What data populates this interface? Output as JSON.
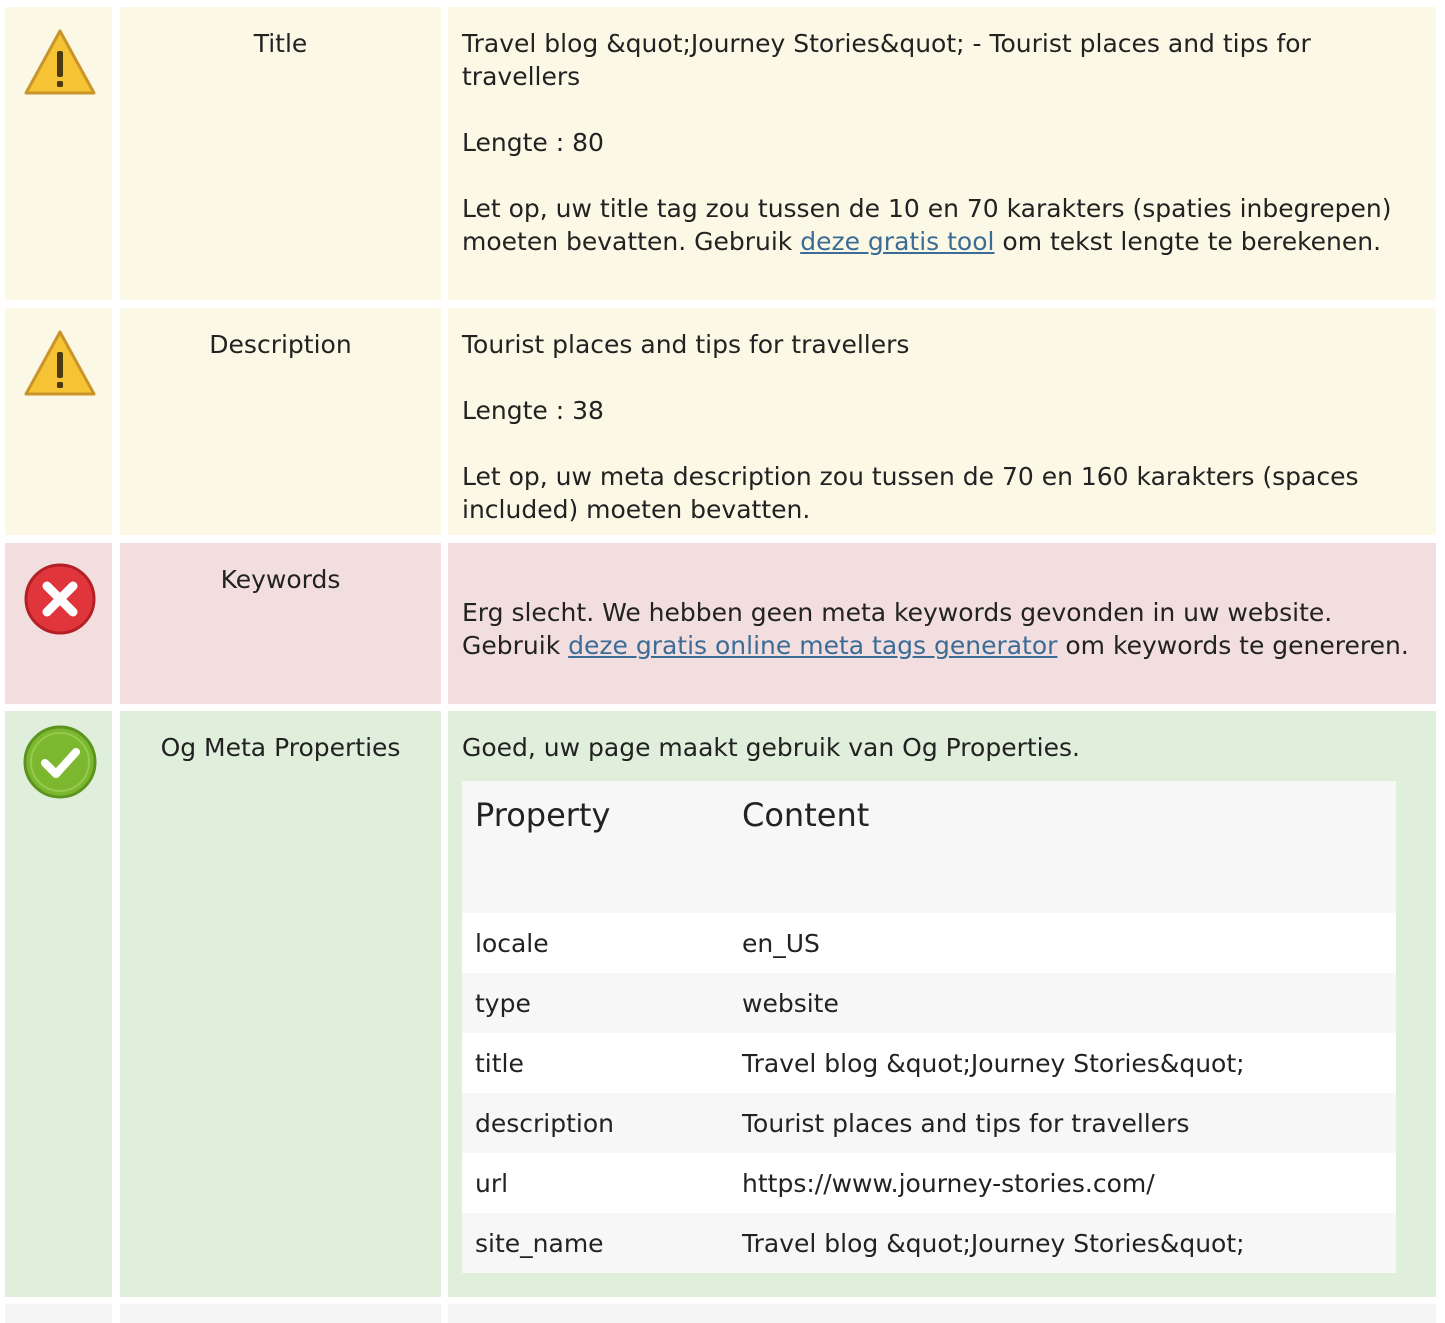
{
  "rows": {
    "title": {
      "status": "warning",
      "label": "Title",
      "value": "Travel blog &quot;Journey Stories&quot; - Tourist places and tips for travellers",
      "length": "Lengte : 80",
      "note_before": "Let op, uw title tag zou tussen de 10 en 70 karakters (spaties inbegrepen) moeten bevatten. Gebruik ",
      "note_link": "deze gratis tool",
      "note_after": " om tekst lengte te berekenen."
    },
    "description": {
      "status": "warning",
      "label": "Description",
      "value": "Tourist places and tips for travellers",
      "length": "Lengte : 38",
      "note": "Let op, uw meta description zou tussen de 70 en 160 karakters (spaces included) moeten bevatten."
    },
    "keywords": {
      "status": "error",
      "label": "Keywords",
      "note_before": "Erg slecht. We hebben geen meta keywords gevonden in uw website. Gebruik ",
      "note_link": "deze gratis online meta tags generator",
      "note_after": " om keywords te genereren."
    },
    "og": {
      "status": "ok",
      "label": "Og Meta Properties",
      "message": "Goed, uw page maakt gebruik van Og Properties.",
      "table_headers": [
        "Property",
        "Content"
      ],
      "properties": [
        {
          "property": "locale",
          "content": "en_US"
        },
        {
          "property": "type",
          "content": "website"
        },
        {
          "property": "title",
          "content": "Travel blog &quot;Journey Stories&quot;"
        },
        {
          "property": "description",
          "content": "Tourist places and tips for travellers"
        },
        {
          "property": "url",
          "content": "https://www.journey-stories.com/"
        },
        {
          "property": "site_name",
          "content": "Travel blog &quot;Journey Stories&quot;"
        }
      ]
    }
  },
  "colors": {
    "warning_bg": "#fcf8e6",
    "error_bg": "#f2dedf",
    "ok_bg": "#dfefdb",
    "link": "#3b6c96"
  },
  "icons": {
    "warning": "warning-triangle-icon",
    "error": "error-x-icon",
    "ok": "check-circle-icon"
  }
}
